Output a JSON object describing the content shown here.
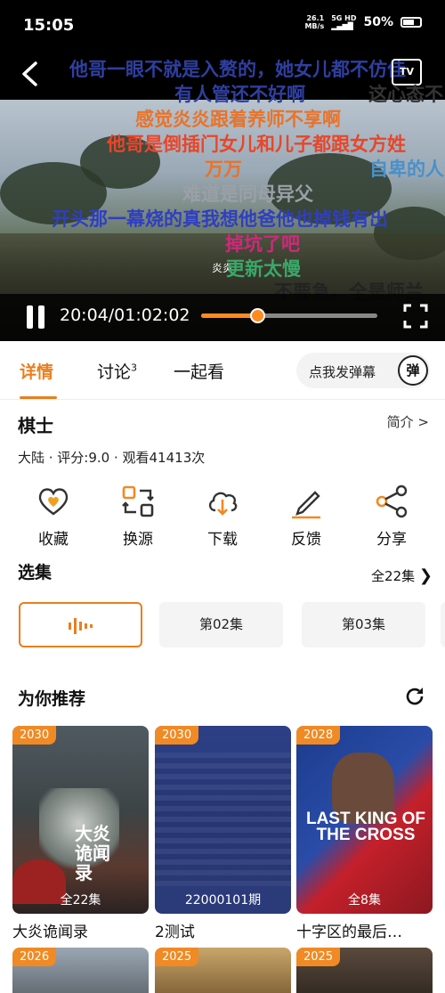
{
  "status_bar": {
    "time": "15:05",
    "net_speed_value": "26.1",
    "net_speed_unit": "MB/s",
    "network": "5G HD",
    "battery": "50%"
  },
  "player": {
    "tv_label": "TV",
    "time": "20:04/01:02:02",
    "progress": 0.32,
    "danmaku": [
      {
        "text": "他哥一眼不就是入赘的，她女儿都不仿佳",
        "color": "#2f3f9f"
      },
      {
        "text": "有人管还不好啊",
        "color": "#2f3f9f"
      },
      {
        "text": "这心态不",
        "color": "#333333"
      },
      {
        "text": "感觉炎炎跟着养师不享啊",
        "color": "#e8732a"
      },
      {
        "text": "他哥是倒插门女儿和儿子都跟女方姓",
        "color": "#e8462a"
      },
      {
        "text": "万万",
        "color": "#e8732a"
      },
      {
        "text": "自卑的人",
        "color": "#4a90c8"
      },
      {
        "text": "难道是同母异父",
        "color": "#9aa0a8"
      },
      {
        "text": "开头那一幕烧的真我想他爸他也掉钱有出",
        "color": "#2f3fbf"
      },
      {
        "text": "掉坑了吧",
        "color": "#d0287a"
      },
      {
        "text": "炎炎",
        "color": "#ffffff"
      },
      {
        "text": "更新太慢",
        "color": "#3aa86a"
      },
      {
        "text": "不要急，全是师兰",
        "color": "#222222"
      }
    ]
  },
  "tabs": [
    {
      "label": "详情"
    },
    {
      "label": "讨论",
      "badge": "3"
    },
    {
      "label": "一起看"
    }
  ],
  "danmaku_input": {
    "placeholder": "点我发弹幕",
    "button": "弹"
  },
  "detail": {
    "title": "棋士",
    "intro_link": "简介 >",
    "meta": "大陆 · 评分:9.0 · 观看41413次"
  },
  "actions": [
    {
      "label": "收藏",
      "icon": "heart-icon"
    },
    {
      "label": "换源",
      "icon": "switch-source-icon"
    },
    {
      "label": "下载",
      "icon": "cloud-download-icon"
    },
    {
      "label": "反馈",
      "icon": "edit-pencil-icon"
    },
    {
      "label": "分享",
      "icon": "share-icon"
    }
  ],
  "episodes": {
    "section_title": "选集",
    "all_label": "全22集",
    "items": [
      {
        "label": "",
        "playing": true
      },
      {
        "label": "第02集"
      },
      {
        "label": "第03集"
      }
    ]
  },
  "recommend": {
    "section_title": "为你推荐",
    "items": [
      {
        "year": "2030",
        "count": "全22集",
        "title": "大炎诡闻录",
        "poster_text": "大炎诡闻录"
      },
      {
        "year": "2030",
        "count": "22000101期",
        "title": "2测试",
        "poster_text": ""
      },
      {
        "year": "2028",
        "count": "全8集",
        "title": "十字区的最后…",
        "poster_text": "LAST KING OF THE CROSS"
      }
    ],
    "row2": [
      {
        "year": "2026"
      },
      {
        "year": "2025"
      },
      {
        "year": "2025"
      }
    ]
  },
  "colors": {
    "accent": "#e87f1e",
    "year_badge": "#f08a24"
  }
}
